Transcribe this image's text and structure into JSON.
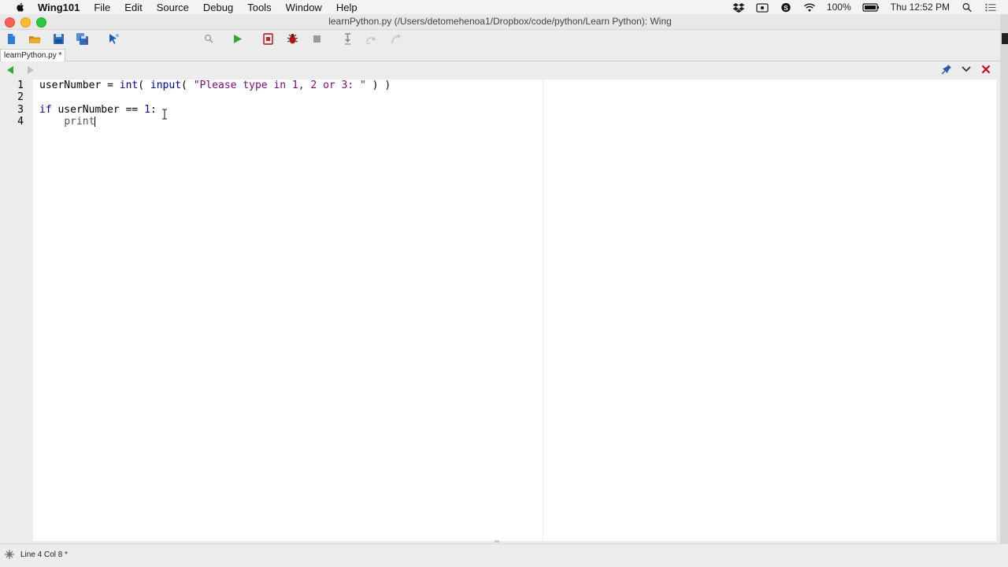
{
  "menubar": {
    "app_name": "Wing101",
    "menus": [
      "File",
      "Edit",
      "Source",
      "Debug",
      "Tools",
      "Window",
      "Help"
    ],
    "battery": "100%",
    "clock": "Thu 12:52 PM"
  },
  "window": {
    "title": "learnPython.py (/Users/detomehenoa1/Dropbox/code/python/Learn Python): Wing"
  },
  "toolbar": {
    "search_value": "",
    "icons": [
      "new-file-icon",
      "open-folder-icon",
      "save-icon",
      "save-all-icon",
      "pointer-icon",
      "search-icon",
      "run-icon",
      "debug-file-icon",
      "bug-icon",
      "stop-icon",
      "step-into-icon",
      "step-over-icon",
      "step-out-icon"
    ]
  },
  "tabs": [
    {
      "label": "learnPython.py *"
    }
  ],
  "editor": {
    "line_numbers": [
      "1",
      "2",
      "3",
      "4"
    ],
    "lines": [
      [
        {
          "t": "userNumber",
          "c": "ident"
        },
        {
          "t": " = ",
          "c": "ident"
        },
        {
          "t": "int",
          "c": "kw"
        },
        {
          "t": "( ",
          "c": "ident"
        },
        {
          "t": "input",
          "c": "kw"
        },
        {
          "t": "( ",
          "c": "ident"
        },
        {
          "t": "\"Please type in 1, 2 or 3: \"",
          "c": "str"
        },
        {
          "t": " ) )",
          "c": "ident"
        }
      ],
      [],
      [
        {
          "t": "if",
          "c": "kw"
        },
        {
          "t": " userNumber == ",
          "c": "ident"
        },
        {
          "t": "1",
          "c": "num"
        },
        {
          "t": ":",
          "c": "ident"
        }
      ],
      [
        {
          "t": "    ",
          "c": "ident"
        },
        {
          "t": "print",
          "c": "fn-print"
        }
      ]
    ]
  },
  "status": {
    "text": "Line 4 Col 8 *"
  },
  "colors": {
    "keyword": "#0000a8",
    "string": "#7a0a7a",
    "run_green": "#2eaa2e",
    "close_red": "#d0021b"
  }
}
